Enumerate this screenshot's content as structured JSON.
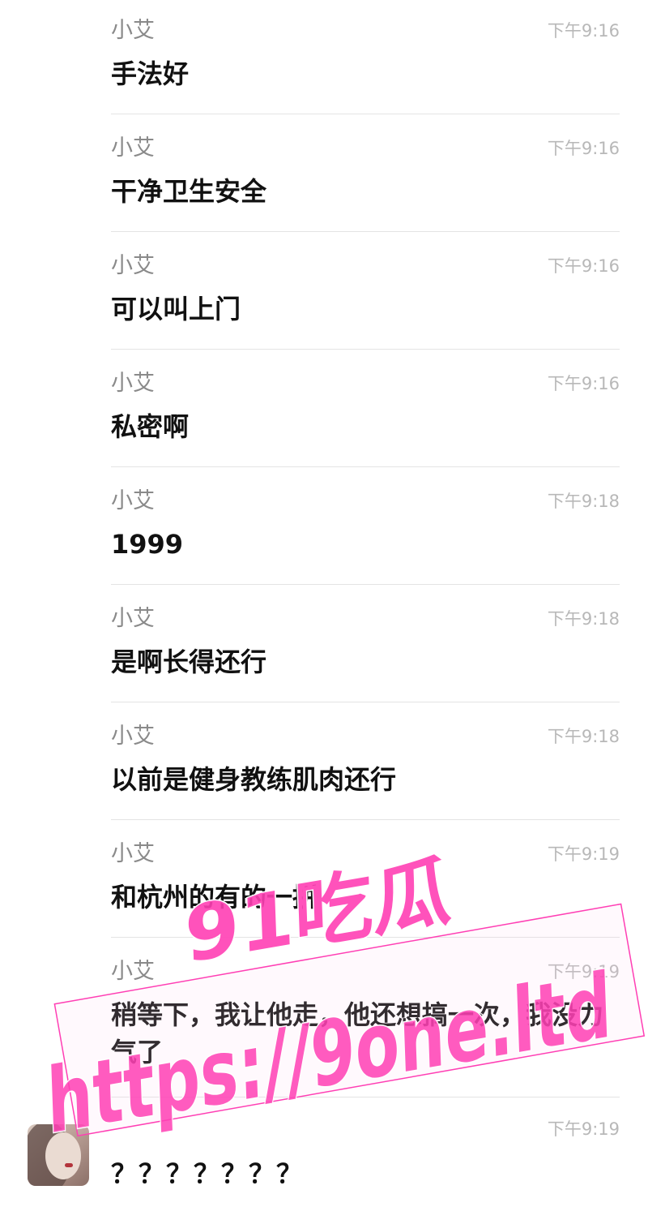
{
  "messages": [
    {
      "sender": "小艾",
      "time": "下午9:16",
      "text": "手法好"
    },
    {
      "sender": "小艾",
      "time": "下午9:16",
      "text": "干净卫生安全"
    },
    {
      "sender": "小艾",
      "time": "下午9:16",
      "text": "可以叫上门"
    },
    {
      "sender": "小艾",
      "time": "下午9:16",
      "text": "私密啊"
    },
    {
      "sender": "小艾",
      "time": "下午9:18",
      "text": "1999"
    },
    {
      "sender": "小艾",
      "time": "下午9:18",
      "text": "是啊长得还行"
    },
    {
      "sender": "小艾",
      "time": "下午9:18",
      "text": "以前是健身教练肌肉还行"
    },
    {
      "sender": "小艾",
      "time": "下午9:19",
      "text": "和杭州的有的一拼"
    },
    {
      "sender": "小艾",
      "time": "下午9:19",
      "text": "稍等下，我让他走，他还想搞一次，我没力气了"
    },
    {
      "sender": "",
      "time": "下午9:19",
      "text": "？？？？？？？"
    }
  ],
  "watermark": {
    "line1": "91吃瓜",
    "line2": "https://9one.ltd",
    "color": "#ff3fb4"
  }
}
